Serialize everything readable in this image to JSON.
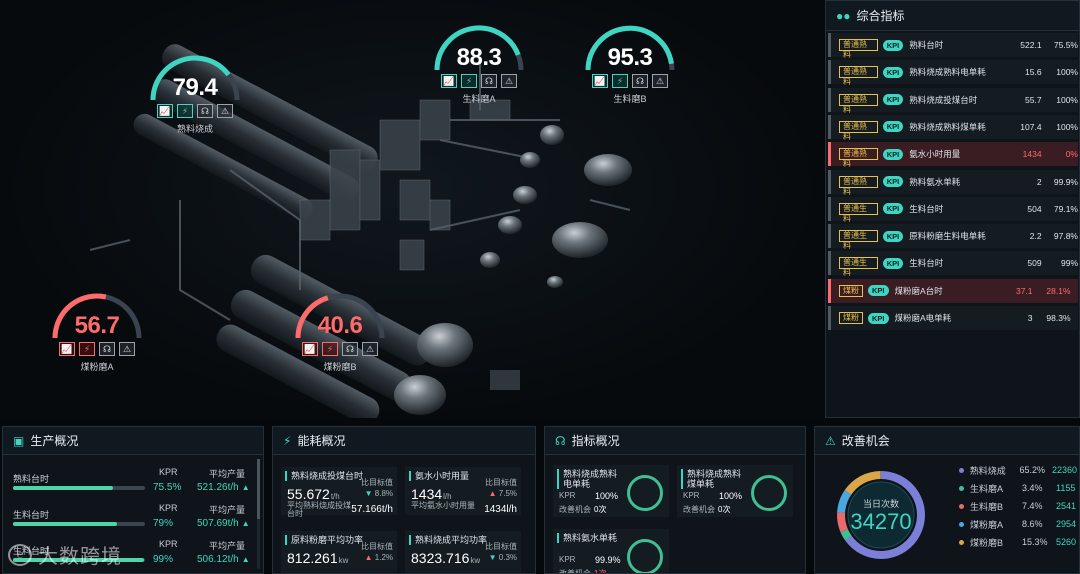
{
  "gauges": [
    {
      "id": "shuliao",
      "value": "79.4",
      "name": "熟料烧成",
      "level": 0.794,
      "status": "normal"
    },
    {
      "id": "shengliaoA",
      "value": "88.3",
      "name": "生料磨A",
      "level": 0.883,
      "status": "normal"
    },
    {
      "id": "shengliaoB",
      "value": "95.3",
      "name": "生料磨B",
      "level": 0.953,
      "status": "normal"
    },
    {
      "id": "meifenA",
      "value": "56.7",
      "name": "煤粉磨A",
      "level": 0.567,
      "status": "alert"
    },
    {
      "id": "meifenB",
      "value": "40.6",
      "name": "煤粉磨B",
      "level": 0.406,
      "status": "alert"
    }
  ],
  "gauge_icons": [
    "chart-icon",
    "bolt-icon",
    "wrench-icon",
    "warning-icon"
  ],
  "gauge_glyphs": [
    "📈",
    "⚡",
    "☊",
    "⚠"
  ],
  "kpi_panel": {
    "title": "综合指标",
    "kpi_badge": "KPI",
    "rows": [
      {
        "tag": "普通熟料",
        "name": "熟料台时",
        "value": "522.1",
        "pct": "75.5%",
        "alert": false
      },
      {
        "tag": "普通熟料",
        "name": "熟料烧成熟料电单耗",
        "value": "15.6",
        "pct": "100%",
        "alert": false
      },
      {
        "tag": "普通熟料",
        "name": "熟料烧成投煤台时",
        "value": "55.7",
        "pct": "100%",
        "alert": false
      },
      {
        "tag": "普通熟料",
        "name": "熟料烧成熟料煤单耗",
        "value": "107.4",
        "pct": "100%",
        "alert": false
      },
      {
        "tag": "普通熟料",
        "name": "氨水小时用量",
        "value": "1434",
        "pct": "0%",
        "alert": true
      },
      {
        "tag": "普通熟料",
        "name": "熟料氨水单耗",
        "value": "2",
        "pct": "99.9%",
        "alert": false
      },
      {
        "tag": "普通生料",
        "name": "生料台时",
        "value": "504",
        "pct": "79.1%",
        "alert": false
      },
      {
        "tag": "普通生料",
        "name": "原料粉磨生料电单耗",
        "value": "2.2",
        "pct": "97.8%",
        "alert": false
      },
      {
        "tag": "普通生料",
        "name": "生料台时",
        "value": "509",
        "pct": "99%",
        "alert": false
      },
      {
        "tag": "煤粉",
        "name": "煤粉磨A台时",
        "value": "37.1",
        "pct": "28.1%",
        "alert": true
      },
      {
        "tag": "煤粉",
        "name": "煤粉磨A电单耗",
        "value": "3",
        "pct": "98.3%",
        "alert": false
      }
    ]
  },
  "production": {
    "title": "生产概况",
    "kpr_label": "KPR",
    "out_label": "平均产量",
    "rows": [
      {
        "name": "熟料台时",
        "kpr": "75.5%",
        "output": "521.26t/h",
        "fill": 0.76
      },
      {
        "name": "生料台时",
        "kpr": "79%",
        "output": "507.69t/h",
        "fill": 0.79
      },
      {
        "name": "生料台时",
        "kpr": "99%",
        "output": "506.12t/h",
        "fill": 0.99
      }
    ]
  },
  "energy": {
    "title": "能耗概况",
    "target_label": "比目标值",
    "cards": [
      {
        "title": "熟料烧成投煤台时",
        "value": "55.672",
        "unit": "t/h",
        "dir": "down",
        "change": "8.8%",
        "sub": "平均熟料烧成投煤台时",
        "subv": "57.166t/h"
      },
      {
        "title": "氨水小时用量",
        "value": "1434",
        "unit": "l/h",
        "dir": "up",
        "change": "7.5%",
        "sub": "平均氨水小时用量",
        "subv": "1434l/h"
      },
      {
        "title": "原料粉磨平均功率",
        "value": "812.261",
        "unit": "kw",
        "dir": "up",
        "change": "1.2%",
        "sub": "",
        "subv": ""
      },
      {
        "title": "熟料烧成平均功率",
        "value": "8323.716",
        "unit": "kw",
        "dir": "down",
        "change": "0.3%",
        "sub": "",
        "subv": ""
      }
    ]
  },
  "indicators": {
    "title": "指标概况",
    "kpr_label": "KPR",
    "opp_label": "改善机会",
    "cards": [
      {
        "title": "熟料烧成熟料电单耗",
        "kpr": "100%",
        "opp": "0次",
        "red": false
      },
      {
        "title": "熟料烧成熟料煤单耗",
        "kpr": "100%",
        "opp": "0次",
        "red": false
      },
      {
        "title": "熟料氨水单耗",
        "kpr": "99.9%",
        "opp": "1次",
        "red": true
      }
    ]
  },
  "improvement": {
    "title": "改善机会",
    "center_label": "当日次数",
    "center_value": "34270",
    "items": [
      {
        "name": "熟料烧成",
        "pct": "65.2%",
        "count": "22360",
        "share": 0.652,
        "color": "#7b7fd8"
      },
      {
        "name": "生料磨A",
        "pct": "3.4%",
        "count": "1155",
        "share": 0.034,
        "color": "#3fbf94"
      },
      {
        "name": "生料磨B",
        "pct": "7.4%",
        "count": "2541",
        "share": 0.074,
        "color": "#e86a6a"
      },
      {
        "name": "煤粉磨A",
        "pct": "8.6%",
        "count": "2954",
        "share": 0.086,
        "color": "#4aa8e0"
      },
      {
        "name": "煤粉磨B",
        "pct": "15.3%",
        "count": "5260",
        "share": 0.153,
        "color": "#d9a64a"
      }
    ]
  },
  "watermark": {
    "text": "大数跨境"
  }
}
